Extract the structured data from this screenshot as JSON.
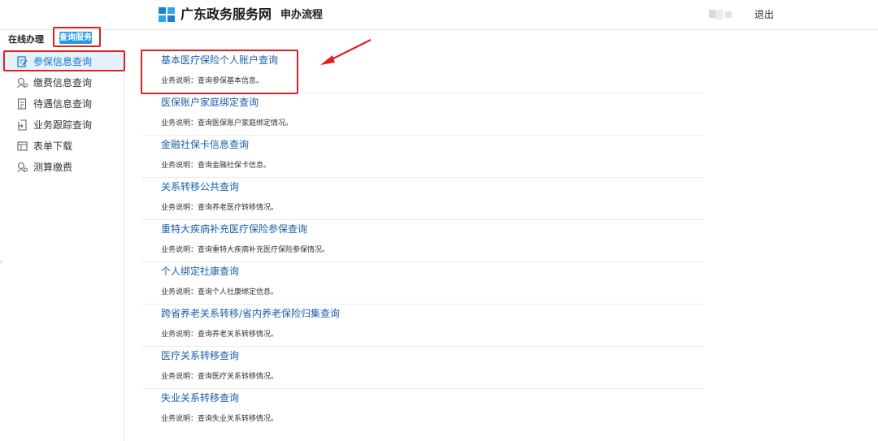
{
  "header": {
    "brand": "广东政务服务网",
    "page_title": "申办流程",
    "logout": "退出",
    "brand_color": "#1e7fd6"
  },
  "tabs": {
    "online": "在线办理",
    "query": "查询服务"
  },
  "sidebar": {
    "items": [
      {
        "label": "参保信息查询",
        "icon": "edit-doc-icon",
        "active": true
      },
      {
        "label": "缴费信息查询",
        "icon": "coin-user-icon",
        "active": false
      },
      {
        "label": "待遇信息查询",
        "icon": "document-icon",
        "active": false
      },
      {
        "label": "业务跟踪查询",
        "icon": "track-doc-icon",
        "active": false
      },
      {
        "label": "表单下载",
        "icon": "table-icon",
        "active": false
      },
      {
        "label": "测算缴费",
        "icon": "coin-user-icon",
        "active": false
      }
    ]
  },
  "services": [
    {
      "title": "基本医疗保险个人账户查询",
      "desc": "业务说明：查询参保基本信息。"
    },
    {
      "title": "医保账户家庭绑定查询",
      "desc": "业务说明：查询医保账户家庭绑定情况。"
    },
    {
      "title": "金融社保卡信息查询",
      "desc": "业务说明：查询金融社保卡信息。"
    },
    {
      "title": "关系转移公共查询",
      "desc": "业务说明：查询养老医疗转移情况。"
    },
    {
      "title": "重特大疾病补充医疗保险参保查询",
      "desc": "业务说明：查询重特大疾病补充医疗保险参保情况。"
    },
    {
      "title": "个人绑定社康查询",
      "desc": "业务说明：查询个人社康绑定信息。"
    },
    {
      "title": "跨省养老关系转移/省内养老保险归集查询",
      "desc": "业务说明：查询养老关系转移情况。"
    },
    {
      "title": "医疗关系转移查询",
      "desc": "业务说明：查询医疗关系转移情况。"
    },
    {
      "title": "失业关系转移查询",
      "desc": "业务说明：查询失业关系转移情况。"
    }
  ]
}
